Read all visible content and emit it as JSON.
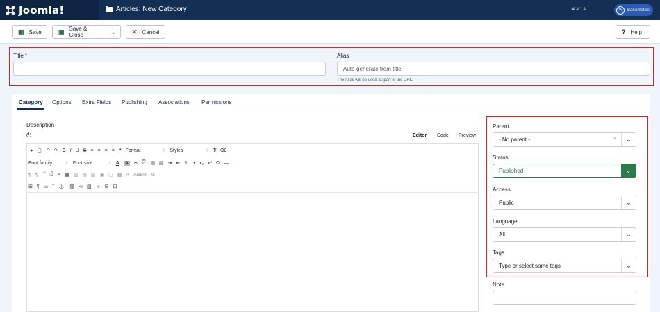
{
  "header": {
    "app_name": "Joomla!",
    "page_title": "Articles: New Category",
    "version": "⌘ 4.1.4",
    "user_label": "Basicmatics"
  },
  "toolbar": {
    "save": "Save",
    "save_close": "Save & Close",
    "cancel": "Cancel",
    "help": "Help"
  },
  "form": {
    "title_label": "Title *",
    "title_value": "",
    "alias_label": "Alias",
    "alias_placeholder": "Auto-generate from title",
    "alias_hint": "The Alias will be used as part of the URL."
  },
  "tabs": [
    "Category",
    "Options",
    "Extra Fields",
    "Publishing",
    "Associations",
    "Permissions"
  ],
  "editor": {
    "description_label": "Description",
    "modes": [
      "Editor",
      "Code",
      "Preview"
    ],
    "format_label": "Format",
    "styles_label": "Styles",
    "font_family_label": "Font family",
    "font_size_label": "Font size"
  },
  "sidebar": {
    "parent_label": "Parent",
    "parent_value": "- No parent -",
    "status_label": "Status",
    "status_value": "Published",
    "access_label": "Access",
    "access_value": "Public",
    "language_label": "Language",
    "language_value": "All",
    "tags_label": "Tags",
    "tags_placeholder": "Type or select some tags",
    "note_label": "Note"
  },
  "colors": {
    "header_bg": "#132f53",
    "brand_bg": "#0d2442",
    "accent_green": "#2f7a4a",
    "highlight_red": "#e02020"
  }
}
